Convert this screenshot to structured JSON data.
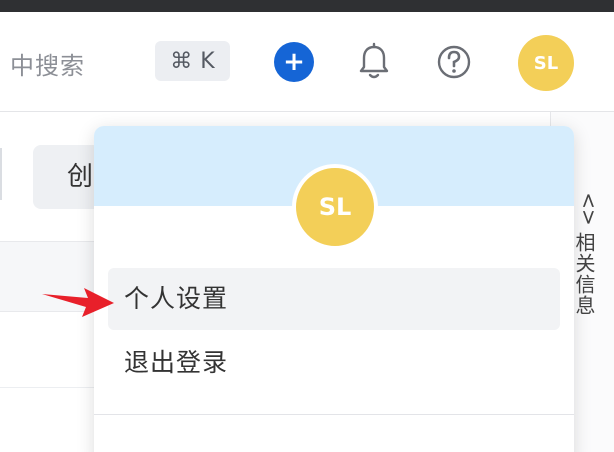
{
  "header": {
    "search_text": "中搜索",
    "shortcut": {
      "symbol": "⌘",
      "key": "K"
    },
    "add_label": "+",
    "avatar_initials": "SL"
  },
  "background": {
    "create_button_label": "创"
  },
  "right_panel": {
    "label": "相关信息",
    "chevron": "<>"
  },
  "dropdown": {
    "avatar_initials": "SL",
    "items": [
      {
        "label": "个人设置"
      },
      {
        "label": "退出登录"
      }
    ]
  },
  "colors": {
    "accent_blue": "#1565d6",
    "avatar_yellow": "#f3cf58",
    "dropdown_header": "#d6edfd",
    "annotation_arrow": "#e8202a"
  },
  "icons": [
    "command-icon",
    "plus-icon",
    "bell-icon",
    "help-icon",
    "chevron-icon",
    "annotation-arrow"
  ]
}
